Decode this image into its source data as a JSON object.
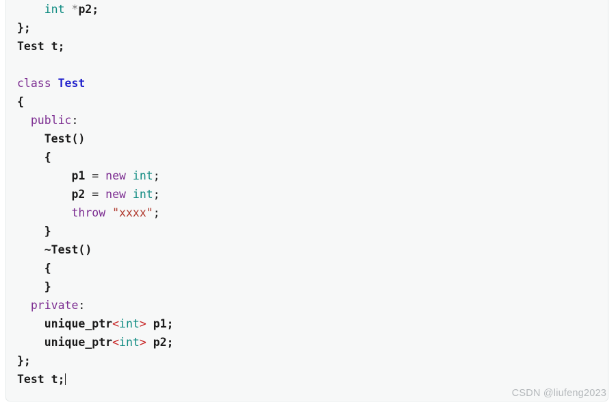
{
  "card": {
    "background_color": "#f7f8f8",
    "border_color": "#e3e8e8"
  },
  "watermark": {
    "text": "CSDN @liufeng2023",
    "color": "#b4b8bb"
  },
  "theme": {
    "keyword_color": "#7c2d91",
    "type_color": "#0d8a80",
    "class_color": "#2222cc",
    "string_color": "#b03a2e",
    "angle_bracket_color": "#c62020",
    "text_color": "#1a1a1a"
  },
  "code": {
    "language": "cpp",
    "caret_after_line_index": 17,
    "lines": [
      {
        "indent": 4,
        "tokens": [
          {
            "t": "int",
            "c": "type"
          },
          {
            "t": " ",
            "c": "plain"
          },
          {
            "t": "*",
            "c": "star"
          },
          {
            "t": "p2;",
            "c": "plain"
          }
        ]
      },
      {
        "indent": 0,
        "tokens": [
          {
            "t": "};",
            "c": "plain"
          }
        ]
      },
      {
        "indent": 0,
        "tokens": [
          {
            "t": "Test t;",
            "c": "plain"
          }
        ]
      },
      {
        "indent": 0,
        "tokens": []
      },
      {
        "indent": 0,
        "tokens": [
          {
            "t": "class",
            "c": "kw"
          },
          {
            "t": " ",
            "c": "plain"
          },
          {
            "t": "Test",
            "c": "cls"
          }
        ]
      },
      {
        "indent": 0,
        "tokens": [
          {
            "t": "{",
            "c": "plain"
          }
        ]
      },
      {
        "indent": 2,
        "tokens": [
          {
            "t": "public",
            "c": "kw"
          },
          {
            "t": ":",
            "c": "punct"
          }
        ]
      },
      {
        "indent": 4,
        "tokens": [
          {
            "t": "Test()",
            "c": "plain"
          }
        ]
      },
      {
        "indent": 4,
        "tokens": [
          {
            "t": "{",
            "c": "plain"
          }
        ]
      },
      {
        "indent": 8,
        "tokens": [
          {
            "t": "p1 ",
            "c": "plain"
          },
          {
            "t": "=",
            "c": "op"
          },
          {
            "t": " ",
            "c": "plain"
          },
          {
            "t": "new",
            "c": "kw"
          },
          {
            "t": " ",
            "c": "plain"
          },
          {
            "t": "int",
            "c": "type"
          },
          {
            "t": ";",
            "c": "punct"
          }
        ]
      },
      {
        "indent": 8,
        "tokens": [
          {
            "t": "p2 ",
            "c": "plain"
          },
          {
            "t": "=",
            "c": "op"
          },
          {
            "t": " ",
            "c": "plain"
          },
          {
            "t": "new",
            "c": "kw"
          },
          {
            "t": " ",
            "c": "plain"
          },
          {
            "t": "int",
            "c": "type"
          },
          {
            "t": ";",
            "c": "punct"
          }
        ]
      },
      {
        "indent": 8,
        "tokens": [
          {
            "t": "throw",
            "c": "kw"
          },
          {
            "t": " ",
            "c": "plain"
          },
          {
            "t": "\"xxxx\"",
            "c": "str"
          },
          {
            "t": ";",
            "c": "punct"
          }
        ]
      },
      {
        "indent": 4,
        "tokens": [
          {
            "t": "}",
            "c": "plain"
          }
        ]
      },
      {
        "indent": 4,
        "tokens": [
          {
            "t": "~Test()",
            "c": "plain"
          }
        ]
      },
      {
        "indent": 4,
        "tokens": [
          {
            "t": "{",
            "c": "plain"
          }
        ]
      },
      {
        "indent": 4,
        "tokens": [
          {
            "t": "}",
            "c": "plain"
          }
        ]
      },
      {
        "indent": 2,
        "tokens": [
          {
            "t": "private",
            "c": "kw"
          },
          {
            "t": ":",
            "c": "punct"
          }
        ]
      },
      {
        "indent": 4,
        "tokens": [
          {
            "t": "unique_ptr",
            "c": "plain"
          },
          {
            "t": "<",
            "c": "angle"
          },
          {
            "t": "int",
            "c": "type"
          },
          {
            "t": ">",
            "c": "angle"
          },
          {
            "t": " p1;",
            "c": "plain"
          }
        ]
      },
      {
        "indent": 4,
        "tokens": [
          {
            "t": "unique_ptr",
            "c": "plain"
          },
          {
            "t": "<",
            "c": "angle"
          },
          {
            "t": "int",
            "c": "type"
          },
          {
            "t": ">",
            "c": "angle"
          },
          {
            "t": " p2;",
            "c": "plain"
          }
        ]
      },
      {
        "indent": 0,
        "tokens": [
          {
            "t": "};",
            "c": "plain"
          }
        ]
      },
      {
        "indent": 0,
        "tokens": [
          {
            "t": "Test t;",
            "c": "plain"
          }
        ],
        "caret": true
      }
    ]
  }
}
